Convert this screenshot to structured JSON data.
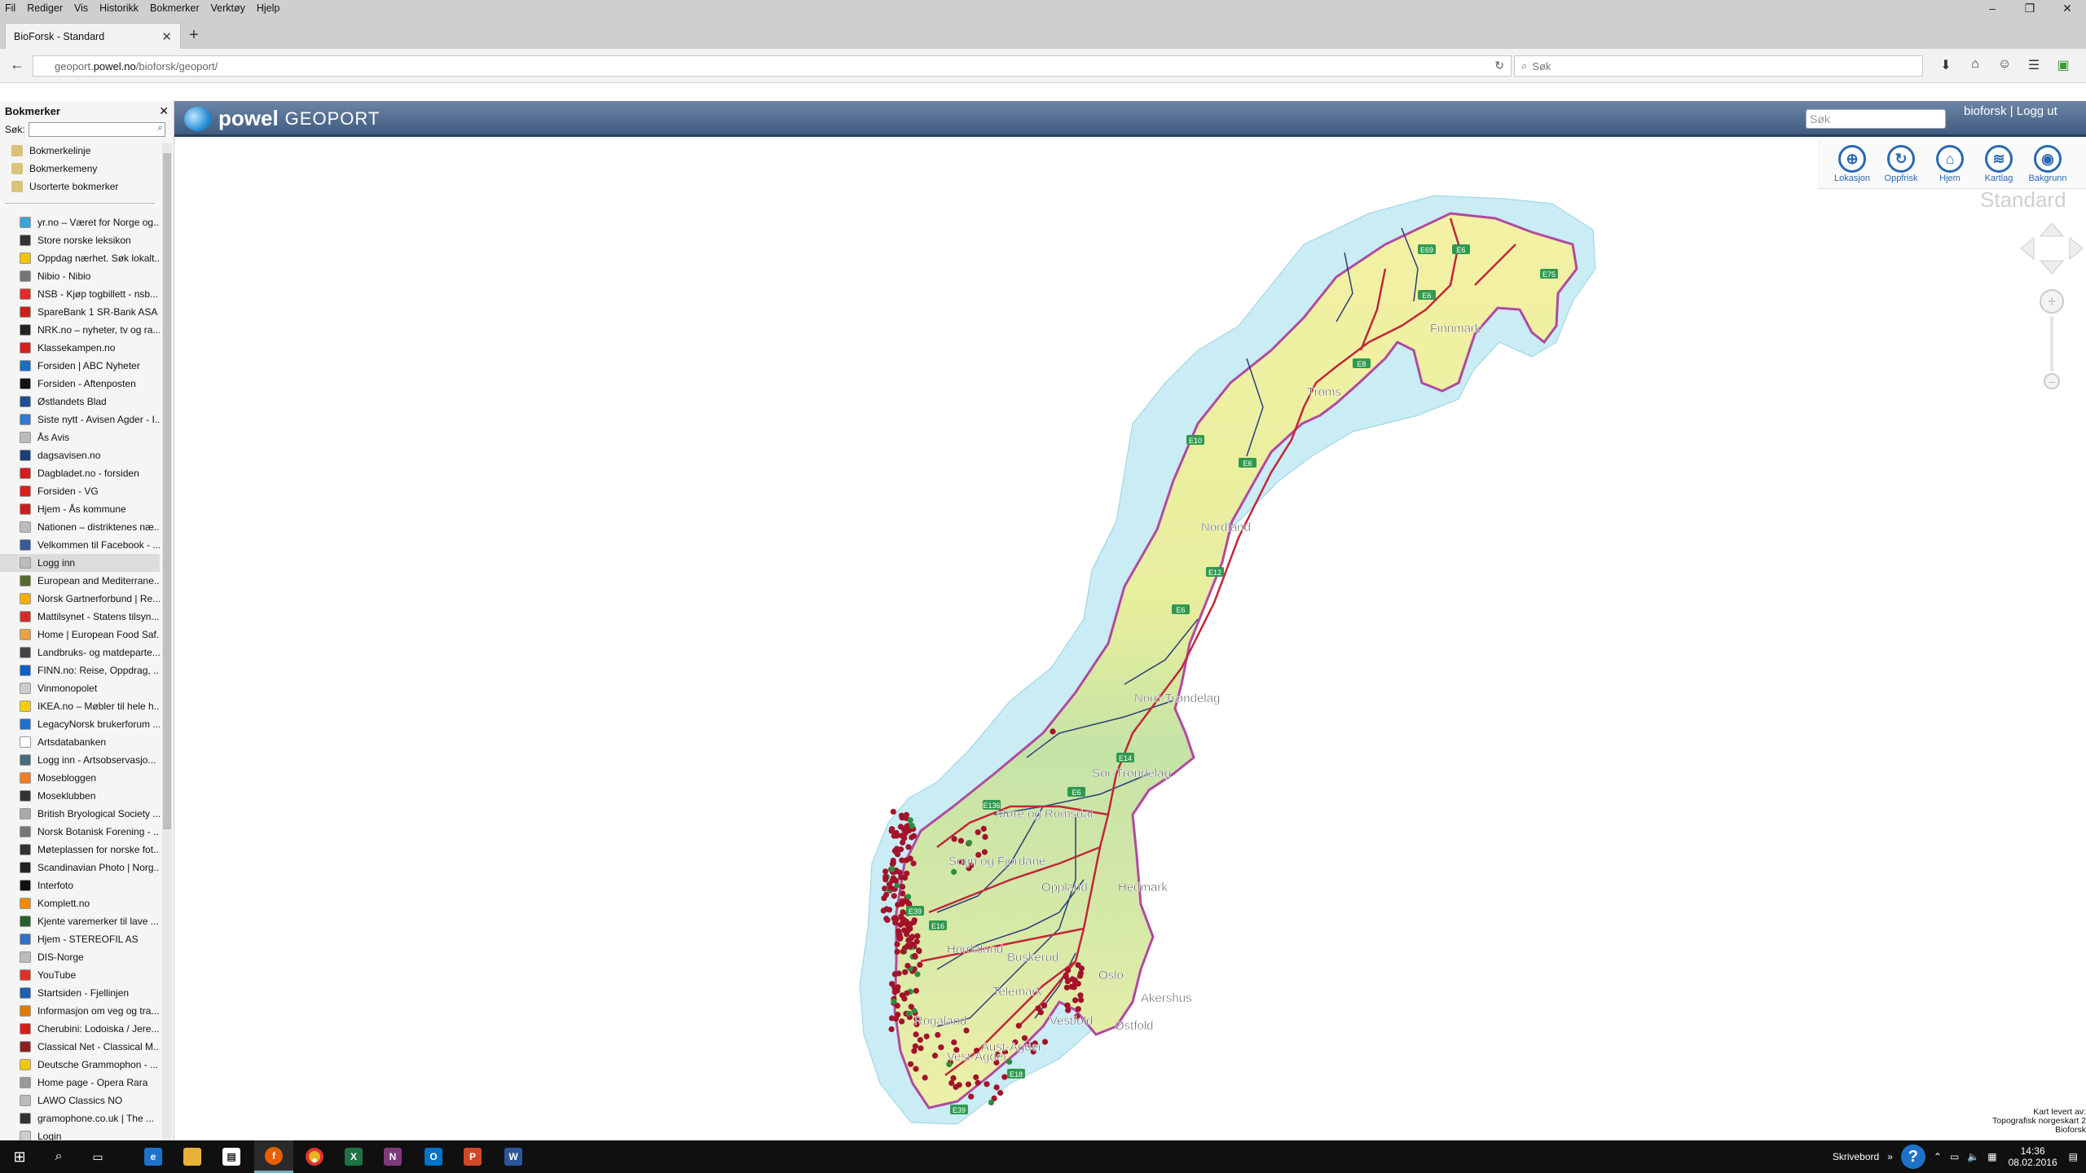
{
  "browser": {
    "menu": [
      {
        "text": "Fil",
        "u": "F"
      },
      {
        "text": "Rediger",
        "u": "R"
      },
      {
        "text": "Vis",
        "u": "V"
      },
      {
        "text": "Historikk",
        "u": "s"
      },
      {
        "text": "Bokmerker",
        "u": "B"
      },
      {
        "text": "Verktøy",
        "u": "k"
      },
      {
        "text": "Hjelp",
        "u": "H"
      }
    ],
    "tab_title": "BioForsk - Standard",
    "url_prefix": "geoport.",
    "url_domain": "powel.no",
    "url_path": "/bioforsk/geoport/",
    "search_placeholder": "Søk"
  },
  "sidebar": {
    "title": "Bokmerker",
    "search_label": "Søk:",
    "folders": [
      "Bokmerkelinje",
      "Bokmerkemeny",
      "Usorterte bokmerker"
    ],
    "items": [
      {
        "label": "yr.no – Været for Norge og...",
        "color": "#3ba3d6"
      },
      {
        "label": "Store norske leksikon",
        "color": "#333333"
      },
      {
        "label": "Oppdag nærhet. Søk lokalt...",
        "color": "#f5c400"
      },
      {
        "label": "Nibio - Nibio",
        "color": "#777777"
      },
      {
        "label": "NSB - Kjøp togbillett - nsb...",
        "color": "#e22b2b"
      },
      {
        "label": "SpareBank 1 SR-Bank ASA",
        "color": "#d11c1c"
      },
      {
        "label": "NRK.no – nyheter, tv og ra...",
        "color": "#222222"
      },
      {
        "label": "Klassekampen.no",
        "color": "#d32020"
      },
      {
        "label": "Forsiden | ABC Nyheter",
        "color": "#1b6ec2"
      },
      {
        "label": "Forsiden - Aftenposten",
        "color": "#111111"
      },
      {
        "label": "Østlandets Blad",
        "color": "#1d4f91"
      },
      {
        "label": "Siste nytt - Avisen Agder - I...",
        "color": "#2e7bd1"
      },
      {
        "label": "Ås Avis",
        "color": "#bbbbbb"
      },
      {
        "label": "dagsavisen.no",
        "color": "#1d3f78"
      },
      {
        "label": "Dagbladet.no - forsiden",
        "color": "#d41c1c"
      },
      {
        "label": "Forsiden - VG",
        "color": "#d81e1e"
      },
      {
        "label": "Hjem - Ås kommune",
        "color": "#c82020"
      },
      {
        "label": "Nationen – distriktenes næ...",
        "color": "#bbbbbb"
      },
      {
        "label": "Velkommen til Facebook - ...",
        "color": "#3b5998"
      },
      {
        "label": "Logg inn",
        "color": "#bbbbbb"
      },
      {
        "label": "European and Mediterrane...",
        "color": "#556b2f"
      },
      {
        "label": "Norsk Gartnerforbund | Re...",
        "color": "#f2b200"
      },
      {
        "label": "Mattilsynet - Statens tilsyn...",
        "color": "#d62a2a"
      },
      {
        "label": "Home | European Food Saf...",
        "color": "#e8a33c"
      },
      {
        "label": "Landbruks- og matdeparte...",
        "color": "#444444"
      },
      {
        "label": "FINN.no: Reise, Oppdrag, ...",
        "color": "#0a63c4"
      },
      {
        "label": "Vinmonopolet",
        "color": "#cccccc"
      },
      {
        "label": "IKEA.no – Møbler til hele h...",
        "color": "#f5d000"
      },
      {
        "label": "LegacyNorsk brukerforum ...",
        "color": "#1f6fd0"
      },
      {
        "label": "Artsdatabanken",
        "color": "#ffffff"
      },
      {
        "label": "Logg inn - Artsobservasjo...",
        "color": "#4c6b7a"
      },
      {
        "label": "Mosebloggen",
        "color": "#f47b20"
      },
      {
        "label": "Moseklubben",
        "color": "#333333"
      },
      {
        "label": "British Bryological Society ...",
        "color": "#aaaaaa"
      },
      {
        "label": "Norsk Botanisk Forening - ...",
        "color": "#777777"
      },
      {
        "label": "Møteplassen for norske fot...",
        "color": "#333333"
      },
      {
        "label": "Scandinavian Photo | Norg...",
        "color": "#222222"
      },
      {
        "label": "Interfoto",
        "color": "#111111"
      },
      {
        "label": "Komplett.no",
        "color": "#f08a00"
      },
      {
        "label": "Kjente varemerker til lave ...",
        "color": "#2b5f2b"
      },
      {
        "label": "Hjem - STEREOFIL AS",
        "color": "#3570c8"
      },
      {
        "label": "DIS-Norge",
        "color": "#bbbbbb"
      },
      {
        "label": "YouTube",
        "color": "#e52d27"
      },
      {
        "label": "Startsiden - Fjellinjen",
        "color": "#1d5fb3"
      },
      {
        "label": "Informasjon om veg og tra...",
        "color": "#e27b00"
      },
      {
        "label": "Cherubini: Lodoiska / Jere...",
        "color": "#d21f1f"
      },
      {
        "label": "Classical Net - Classical M...",
        "color": "#8a2020"
      },
      {
        "label": "Deutsche Grammophon - ...",
        "color": "#f0c800"
      },
      {
        "label": "Home page - Opera Rara",
        "color": "#999999"
      },
      {
        "label": "LAWO Classics NO",
        "color": "#bbbbbb"
      },
      {
        "label": "gramophone.co.uk | The ...",
        "color": "#333333"
      },
      {
        "label": "Login",
        "color": "#cccccc"
      }
    ]
  },
  "geoport": {
    "brand_bold": "powel",
    "brand_light": "GEOPORT",
    "search_placeholder": "Søk",
    "user": "bioforsk | Logg ut",
    "tools": [
      {
        "label": "Lokasjon",
        "icon": "location-icon",
        "glyph": "⊕"
      },
      {
        "label": "Oppfrisk",
        "icon": "refresh-icon",
        "glyph": "↻"
      },
      {
        "label": "Hjem",
        "icon": "home-icon",
        "glyph": "⌂"
      },
      {
        "label": "Kartlag",
        "icon": "layers-icon",
        "glyph": "≋"
      },
      {
        "label": "Bakgrunn",
        "icon": "globe-icon",
        "glyph": "◉"
      }
    ],
    "background_label": "Standard",
    "attribution": [
      "Kart levert av:",
      "Topografisk norgeskart 2",
      "Bioforsk"
    ]
  },
  "map": {
    "colors": {
      "sea": "#c9ecf5",
      "land_north": "#f3f0a6",
      "land_mid": "#cfe6a8",
      "land_south": "#e9f0b0",
      "border": "#b04aa0",
      "road": "#c0273a",
      "county": "#2c3f7a",
      "point": "#a3122b",
      "point_green": "#2c8f3c"
    },
    "regions": [
      {
        "name": "Finnmark"
      },
      {
        "name": "Troms"
      },
      {
        "name": "Nordland"
      },
      {
        "name": "Nord-Trøndelag"
      },
      {
        "name": "Sør-Trøndelag"
      },
      {
        "name": "Møre og Romsdal"
      },
      {
        "name": "Sogn og Fjordane"
      },
      {
        "name": "Oppland"
      },
      {
        "name": "Hedmark"
      },
      {
        "name": "Hordaland"
      },
      {
        "name": "Buskerud"
      },
      {
        "name": "Akershus"
      },
      {
        "name": "Oslo"
      },
      {
        "name": "Telemark"
      },
      {
        "name": "Vestfold"
      },
      {
        "name": "Østfold"
      },
      {
        "name": "Rogaland"
      },
      {
        "name": "Aust-Agder"
      },
      {
        "name": "Vest-Agder"
      }
    ],
    "road_shields": [
      "E6",
      "E69",
      "E75",
      "E6",
      "E8",
      "E10",
      "E6",
      "E12",
      "E6",
      "E14",
      "E6",
      "E136",
      "E39",
      "E16",
      "E18",
      "E39"
    ]
  },
  "taskbar": {
    "apps": [
      "start",
      "search",
      "taskview",
      "edge",
      "explorer",
      "store",
      "firefox",
      "chrome",
      "excel",
      "onenote",
      "outlook",
      "powerpoint",
      "word"
    ],
    "tray_label": "Skrivebord",
    "time": "14:36",
    "date": "08.02.2016"
  }
}
